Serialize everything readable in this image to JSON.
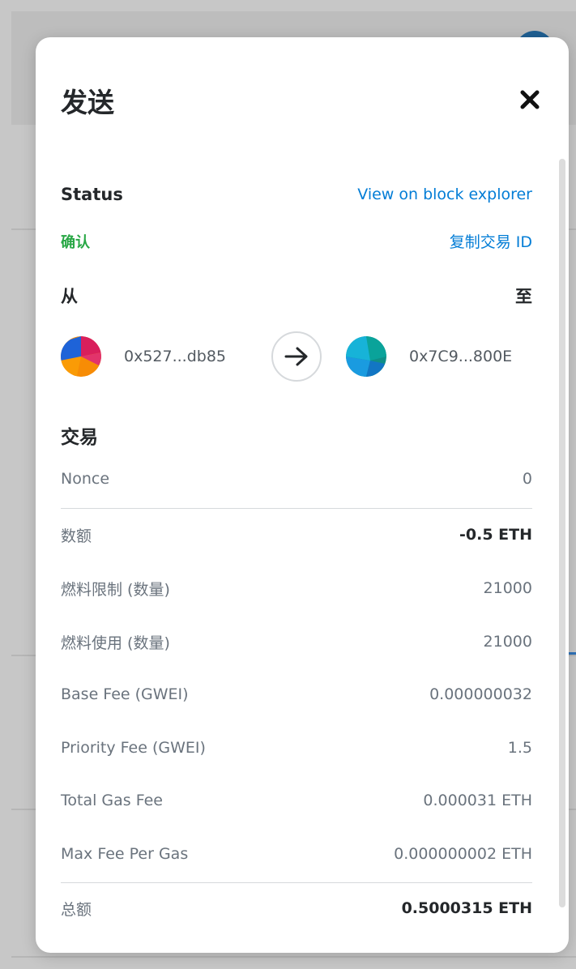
{
  "modal": {
    "title": "发送",
    "close_icon": "close-icon"
  },
  "status": {
    "label": "Status",
    "value": "确认",
    "value_color": "#28a745",
    "explorer_link": "View on block explorer",
    "copy_tx_link": "复制交易 ID"
  },
  "parties": {
    "from_label": "从",
    "to_label": "至",
    "from_address": "0x527...db85",
    "to_address": "0x7C9...800E"
  },
  "transaction": {
    "title": "交易",
    "rows": [
      {
        "label": "Nonce",
        "value": "0"
      },
      {
        "label": "数额",
        "value": "-0.5 ETH"
      },
      {
        "label": "燃料限制 (数量)",
        "value": "21000"
      },
      {
        "label": "燃料使用 (数量)",
        "value": "21000"
      },
      {
        "label": "Base Fee (GWEI)",
        "value": "0.000000032"
      },
      {
        "label": "Priority Fee (GWEI)",
        "value": "1.5"
      },
      {
        "label": "Total Gas Fee",
        "value": "0.000031 ETH"
      },
      {
        "label": "Max Fee Per Gas",
        "value": "0.000000002 ETH"
      },
      {
        "label": "总额",
        "value": "0.5000315 ETH"
      }
    ]
  },
  "colors": {
    "link": "#037dd6",
    "text_dark": "#24272a",
    "text_muted": "#6a737d"
  }
}
